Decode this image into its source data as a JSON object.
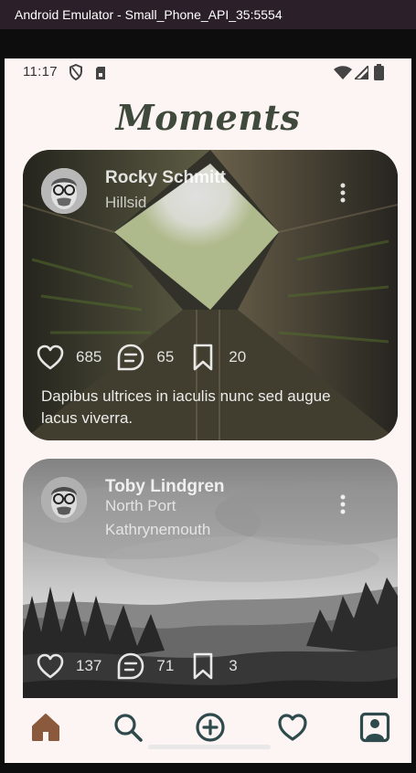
{
  "window": {
    "title": "Android Emulator - Small_Phone_API_35:5554"
  },
  "status_bar": {
    "time": "11:17"
  },
  "app": {
    "title": "Moments"
  },
  "posts": [
    {
      "user": "Rocky Schmitt",
      "location_line1": "Hillsid",
      "likes": "685",
      "comments": "65",
      "saves": "20",
      "caption": "Dapibus ultrices in iaculis nunc sed augue lacus viverra."
    },
    {
      "user": "Toby Lindgren",
      "location_line1": "North Port",
      "location_line2": "Kathrynemouth",
      "likes": "137",
      "comments": "71",
      "saves": "3"
    }
  ],
  "nav": {
    "tabs": [
      "home-icon",
      "search-icon",
      "add-icon",
      "heart-icon",
      "profile-icon"
    ],
    "active": "home-icon",
    "active_color": "#8b5a3c",
    "inactive_color": "#2f4a4c"
  }
}
